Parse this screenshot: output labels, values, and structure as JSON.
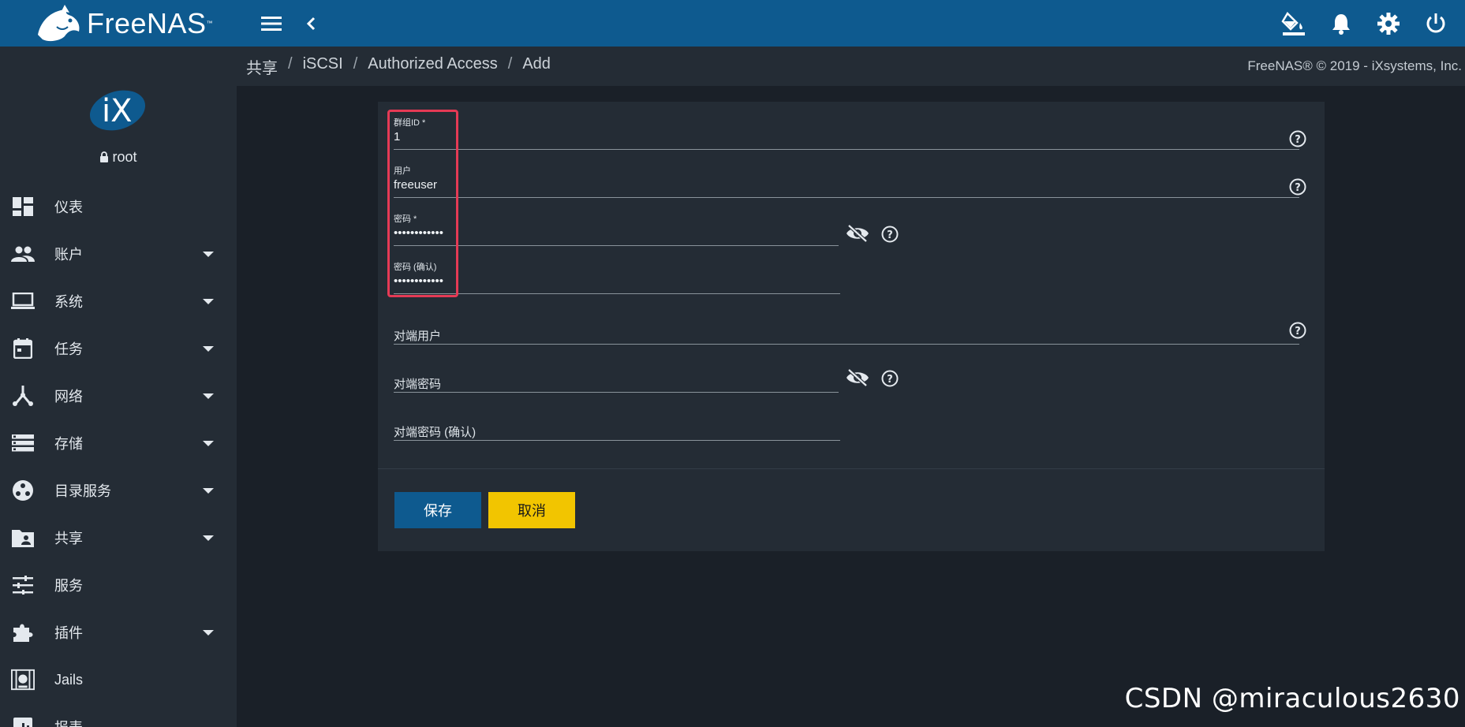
{
  "app": {
    "logo_text": "FreeNAS",
    "logo_tm": "™"
  },
  "topbar": {
    "icons": [
      "menu-icon",
      "chevron-left-icon",
      "paint-bucket-icon",
      "bell-icon",
      "gear-icon",
      "power-icon"
    ]
  },
  "sidebar": {
    "user": "root",
    "items": [
      {
        "label": "仪表",
        "icon": "dashboard-icon",
        "has_caret": false
      },
      {
        "label": "账户",
        "icon": "people-icon",
        "has_caret": true
      },
      {
        "label": "系统",
        "icon": "laptop-icon",
        "has_caret": true
      },
      {
        "label": "任务",
        "icon": "calendar-icon",
        "has_caret": true
      },
      {
        "label": "网络",
        "icon": "network-icon",
        "has_caret": true
      },
      {
        "label": "存储",
        "icon": "storage-icon",
        "has_caret": true
      },
      {
        "label": "目录服务",
        "icon": "directory-icon",
        "has_caret": true
      },
      {
        "label": "共享",
        "icon": "folder-shared-icon",
        "has_caret": true
      },
      {
        "label": "服务",
        "icon": "tune-icon",
        "has_caret": false
      },
      {
        "label": "插件",
        "icon": "puzzle-icon",
        "has_caret": true
      },
      {
        "label": "Jails",
        "icon": "jail-icon",
        "has_caret": false
      },
      {
        "label": "报表",
        "icon": "chart-icon",
        "has_caret": false
      }
    ]
  },
  "breadcrumb": {
    "items": [
      "共享",
      "iSCSI",
      "Authorized Access",
      "Add"
    ],
    "separator": "/"
  },
  "copyright": "FreeNAS® © 2019 - iXsystems, Inc.",
  "form": {
    "group_id": {
      "label": "群组ID *",
      "value": "1"
    },
    "user": {
      "label": "用户",
      "value": "freeuser"
    },
    "password": {
      "label": "密码 *",
      "value": "••••••••••••"
    },
    "password_confirm": {
      "label": "密码 (确认)",
      "value": "••••••••••••"
    },
    "peer_user": {
      "placeholder": "对端用户"
    },
    "peer_password": {
      "placeholder": "对端密码"
    },
    "peer_password_confirm": {
      "placeholder": "对端密码 (确认)"
    },
    "save_label": "保存",
    "cancel_label": "取消"
  },
  "watermark": "CSDN @miraculous2630",
  "colors": {
    "topbar": "#0e5a8f",
    "sidebar": "#242c35",
    "background": "#1a2028",
    "save_button": "#0e5a8f",
    "cancel_button": "#f2c500",
    "highlight": "#e53a55"
  }
}
